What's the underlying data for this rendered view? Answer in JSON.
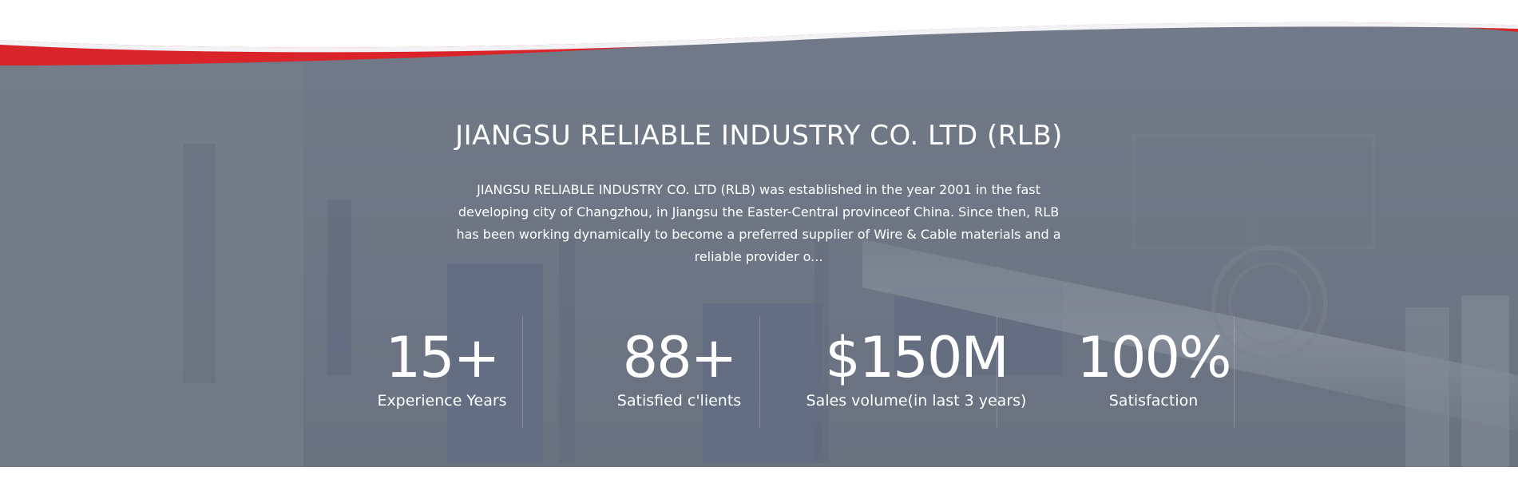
{
  "section": {
    "title": "JIANGSU RELIABLE INDUSTRY CO. LTD (RLB)",
    "description": "JIANGSU RELIABLE INDUSTRY CO. LTD (RLB) was established in the year 2001 in the fast developing city of Changzhou, in Jiangsu the Easter-Central provinceof China. Since then, RLB has been working dynamically to become a preferred supplier of Wire & Cable materials and a reliable provider o..."
  },
  "stats": [
    {
      "number": "15+",
      "label": "Experience Years"
    },
    {
      "number": "88+",
      "label": "Satisfied c'lients"
    },
    {
      "number": "$150M",
      "label": "Sales volume(in last 3 years)"
    },
    {
      "number": "100%",
      "label": "Satisfaction"
    }
  ],
  "colors": {
    "accent_red": "#d9252a",
    "overlay": "#6f7786",
    "text": "#ffffff"
  }
}
